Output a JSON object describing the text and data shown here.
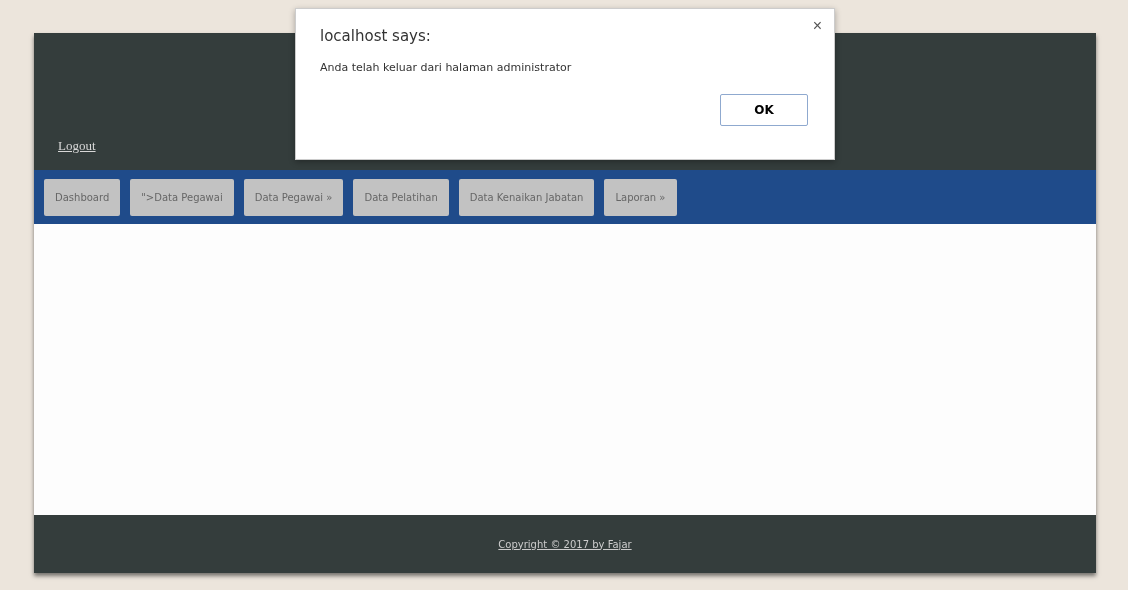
{
  "header": {
    "logout_link": "Logout"
  },
  "nav": [
    {
      "label": "Dashboard"
    },
    {
      "label": "\">Data Pegawai"
    },
    {
      "label": "Data Pegawai »"
    },
    {
      "label": "Data Pelatihan"
    },
    {
      "label": "Data Kenaikan Jabatan"
    },
    {
      "label": "Laporan »"
    }
  ],
  "footer": {
    "copyright": "Copyright © 2017 by Fajar"
  },
  "dialog": {
    "title": "localhost says:",
    "message": "Anda telah keluar dari halaman administrator",
    "close": "×",
    "button": "OK"
  }
}
